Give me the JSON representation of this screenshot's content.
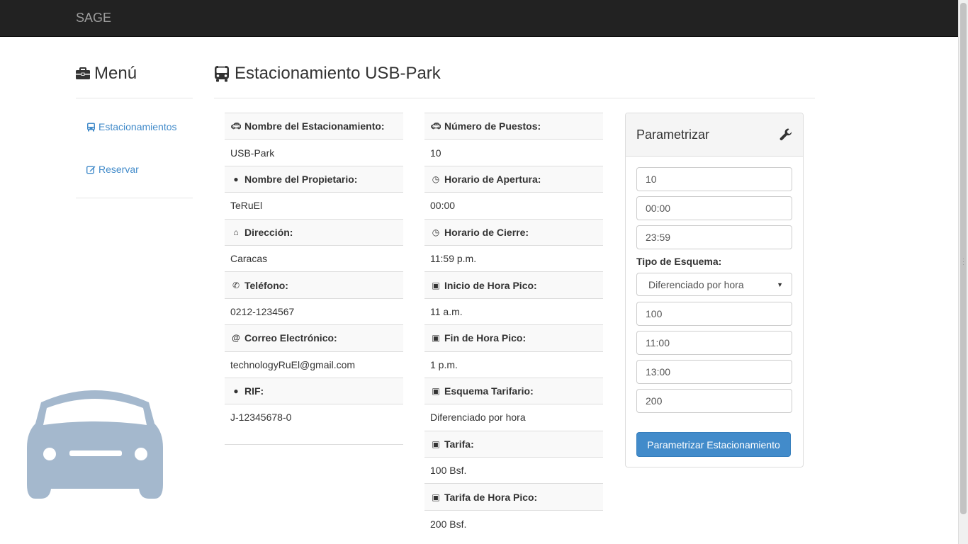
{
  "navbar": {
    "brand": "SAGE"
  },
  "sidebar": {
    "title": "Menú",
    "items": [
      {
        "label": "Estacionamientos",
        "icon": "bus-icon"
      },
      {
        "label": "Reservar",
        "icon": "edit-icon"
      }
    ]
  },
  "main": {
    "title": "Estacionamiento USB-Park",
    "left_table": [
      {
        "label": "Nombre del Estacionamiento:",
        "value": "USB-Park",
        "icon": "car-icon"
      },
      {
        "label": "Nombre del Propietario:",
        "value": "TeRuEl",
        "icon": "user-icon"
      },
      {
        "label": "Dirección:",
        "value": "Caracas",
        "icon": "home-icon"
      },
      {
        "label": "Teléfono:",
        "value": "0212-1234567",
        "icon": "phone-icon"
      },
      {
        "label": "Correo Electrónico:",
        "value": "technologyRuEl@gmail.com",
        "icon": "at-icon"
      },
      {
        "label": "RIF:",
        "value": "J-12345678-0",
        "icon": "circle-icon"
      }
    ],
    "right_table": [
      {
        "label": "Número de Puestos:",
        "value": "10",
        "icon": "car-icon"
      },
      {
        "label": "Horario de Apertura:",
        "value": "00:00",
        "icon": "clock-icon"
      },
      {
        "label": "Horario de Cierre:",
        "value": "11:59 p.m.",
        "icon": "clock-icon"
      },
      {
        "label": "Inicio de Hora Pico:",
        "value": "11 a.m.",
        "icon": "money-icon"
      },
      {
        "label": "Fin de Hora Pico:",
        "value": "1 p.m.",
        "icon": "money-icon"
      },
      {
        "label": "Esquema Tarifario:",
        "value": "Diferenciado por hora",
        "icon": "money-icon"
      },
      {
        "label": "Tarifa:",
        "value": "100 Bsf.",
        "icon": "money-icon"
      },
      {
        "label": "Tarifa de Hora Pico:",
        "value": "200 Bsf.",
        "icon": "money-icon"
      }
    ]
  },
  "panel": {
    "title": "Parametrizar",
    "puestos": "10",
    "apertura": "00:00",
    "cierre": "23:59",
    "schema_label": "Tipo de Esquema:",
    "schema_selected": "Diferenciado por hora",
    "tarifa": "100",
    "inicio_pico": "11:00",
    "fin_pico": "13:00",
    "tarifa_pico": "200",
    "submit_label": "Parametrizar Estacionamiento"
  },
  "colors": {
    "navbar": "#222222",
    "link": "#428bca",
    "primary": "#428bca",
    "car": "#a4b8cd"
  }
}
